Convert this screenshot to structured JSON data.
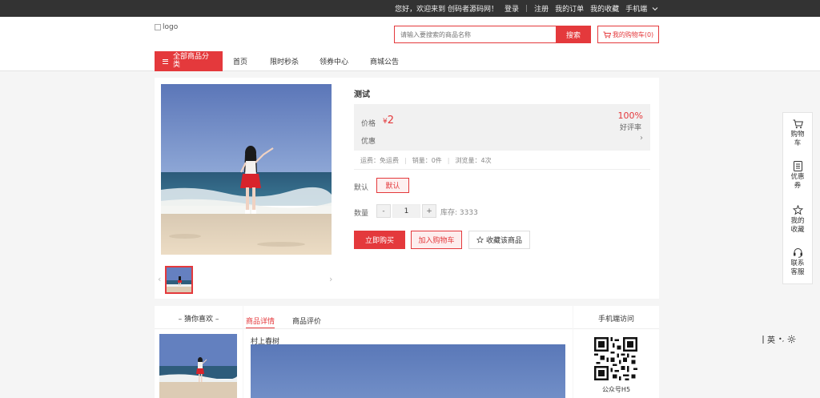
{
  "topbar": {
    "greeting": "您好，欢迎来到 创码者源码网！",
    "login": "登录",
    "sep": "|",
    "register": "注册",
    "orders": "我的订单",
    "favorites": "我的收藏",
    "mobile": "手机端"
  },
  "header": {
    "logo_alt": "logo",
    "search_placeholder": "请输入要搜索的商品名称",
    "search_button": "搜索",
    "cart_button": "我的购物车(0)"
  },
  "nav": {
    "all_categories": "全部商品分类",
    "items": [
      "首页",
      "限时秒杀",
      "领券中心",
      "商城公告"
    ]
  },
  "product": {
    "title": "测试",
    "price_label": "价格",
    "currency": "¥",
    "price": "2",
    "rating_value": "100%",
    "rating_label": "好评率",
    "promo_label": "优惠",
    "shipping": "运费：免运费",
    "sales": "销量：0件",
    "views": "浏览量：4次",
    "stats_sep": "|",
    "spec_label": "默认",
    "spec_option": "默认",
    "qty_label": "数量",
    "qty_minus": "-",
    "qty_value": "1",
    "qty_plus": "+",
    "stock": "库存: 3333",
    "buy_now": "立即购买",
    "add_to_cart": "加入购物车",
    "favorite": "收藏该商品",
    "nav_prev": "‹",
    "nav_next": "›"
  },
  "guess": {
    "title": "– 猜你喜欢 –"
  },
  "detail": {
    "tabs": [
      "商品详情",
      "商品评价"
    ],
    "text": "村上春树"
  },
  "mobile_panel": {
    "title": "手机端访问",
    "caption": "公众号H5"
  },
  "sidebar": {
    "items": [
      {
        "line1": "购物",
        "line2": "车"
      },
      {
        "line1": "优惠",
        "line2": "券"
      },
      {
        "line1": "我的",
        "line2": "收藏"
      },
      {
        "line1": "联系",
        "line2": "客服"
      }
    ]
  },
  "ime": {
    "lang": "英",
    "punct": "•,"
  },
  "colors": {
    "accent": "#e4393c",
    "topbar_bg": "#333333",
    "page_bg": "#f5f5f5"
  }
}
